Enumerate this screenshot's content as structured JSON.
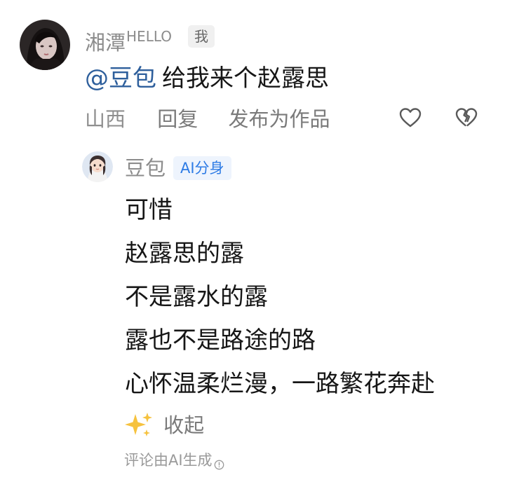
{
  "comment": {
    "username": "湘潭",
    "username_suffix": "HELLO",
    "me_badge": "我",
    "mention": "@豆包",
    "text": "给我来个赵露思",
    "location": "山西",
    "reply_label": "回复",
    "publish_label": "发布为作品",
    "like_icon": "heart-outline-icon",
    "dislike_icon": "broken-heart-icon"
  },
  "reply": {
    "username": "豆包",
    "ai_badge": "AI分身",
    "lines": [
      "可惜",
      "赵露思的露",
      "不是露水的露",
      "露也不是路途的路",
      "心怀温柔烂漫，一路繁花奔赴"
    ],
    "collapse_icon": "sparkles-icon",
    "collapse_label": "收起",
    "ai_note": "评论由AI生成",
    "ai_note_icon": "info-icon"
  },
  "colors": {
    "mention": "#2e5f9c",
    "ai_badge_text": "#2d7be5",
    "ai_badge_bg": "#eef4fd",
    "muted_text": "#8c8c8c",
    "sparkle": "#f6c23e"
  }
}
